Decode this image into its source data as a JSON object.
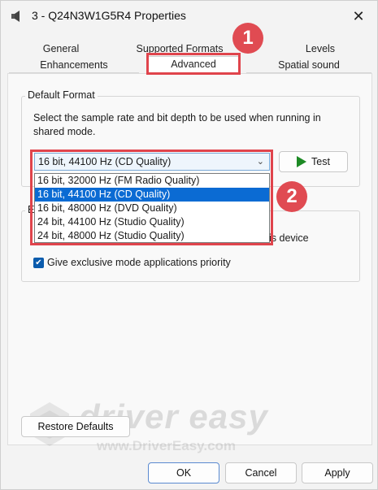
{
  "window": {
    "title": "3 - Q24N3W1G5R4 Properties",
    "close_glyph": "✕"
  },
  "tabs": {
    "row1": [
      "General",
      "Supported Formats",
      "Levels"
    ],
    "row2": [
      "Enhancements",
      "Advanced",
      "Spatial sound"
    ],
    "active": "Advanced"
  },
  "default_format": {
    "group_label": "Default Format",
    "description": "Select the sample rate and bit depth to be used when running in shared mode.",
    "selected": "16 bit, 44100 Hz (CD Quality)",
    "options": [
      "16 bit, 32000 Hz (FM Radio Quality)",
      "16 bit, 44100 Hz (CD Quality)",
      "16 bit, 48000 Hz (DVD Quality)",
      "24 bit, 44100 Hz (Studio Quality)",
      "24 bit, 48000 Hz (Studio Quality)"
    ],
    "test_label": "Test"
  },
  "exclusive": {
    "group_label_fragment": "E",
    "clipped_text": "is device",
    "priority_label": "Give exclusive mode applications priority",
    "priority_checked": true
  },
  "restore_label": "Restore Defaults",
  "footer": {
    "ok": "OK",
    "cancel": "Cancel",
    "apply": "Apply"
  },
  "annotations": {
    "badge1": "1",
    "badge2": "2"
  },
  "watermark": {
    "brand": "driver easy",
    "url": "www.DriverEasy.com"
  },
  "colors": {
    "highlight": "#e0444c",
    "selection": "#0b6bd3",
    "play": "#1d8a25"
  }
}
